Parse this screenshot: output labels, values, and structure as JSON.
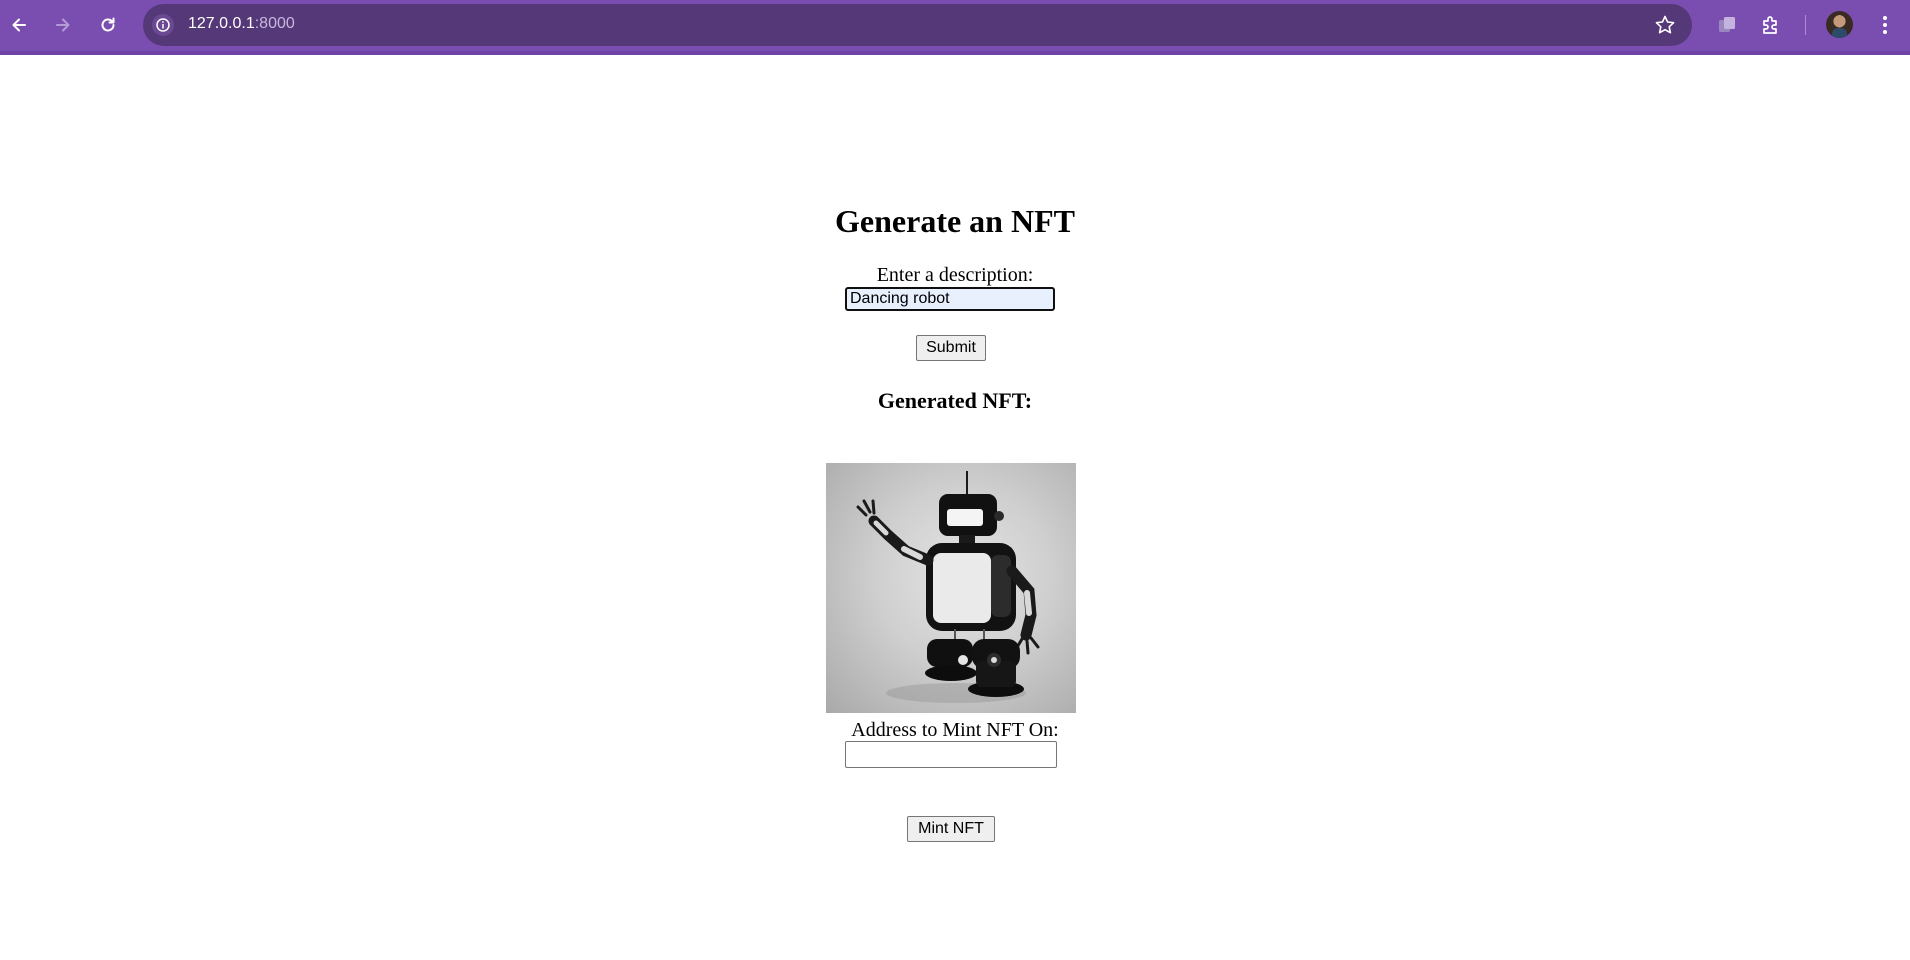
{
  "browser": {
    "url_host": "127.0.0.1",
    "url_port": ":8000",
    "icons": [
      "back-arrow-icon",
      "forward-arrow-icon",
      "reload-icon",
      "site-info-icon",
      "bookmark-star-icon",
      "tab-search-icon",
      "extensions-icon",
      "profile-avatar",
      "more-menu-icon"
    ],
    "chrome_color": "#7a4db1",
    "omnibox_color": "#553877"
  },
  "page": {
    "title": "Generate an NFT",
    "description_label": "Enter a description:",
    "description_value": "Dancing robot",
    "submit_label": "Submit",
    "generated_heading": "Generated NFT:",
    "address_label": "Address to Mint NFT On:",
    "address_value": "",
    "mint_label": "Mint NFT"
  }
}
